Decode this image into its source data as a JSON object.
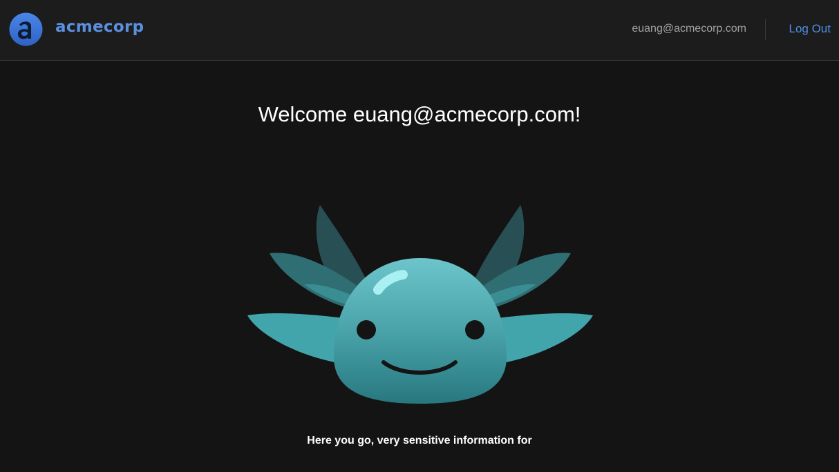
{
  "header": {
    "logo_icon": "acmecorp-logo-icon",
    "brand": "acmecorp",
    "user_email": "euang@acmecorp.com",
    "logout_label": "Log Out"
  },
  "main": {
    "welcome": "Welcome euang@acmecorp.com!",
    "mascot_icon": "axolotl-mascot",
    "info_text": "Here you go, very sensitive information for"
  },
  "colors": {
    "background": "#141414",
    "header_bg": "#1c1c1c",
    "brand": "#5b8fe0",
    "link": "#4f8fe6",
    "mascot": "#3e9ea6"
  }
}
